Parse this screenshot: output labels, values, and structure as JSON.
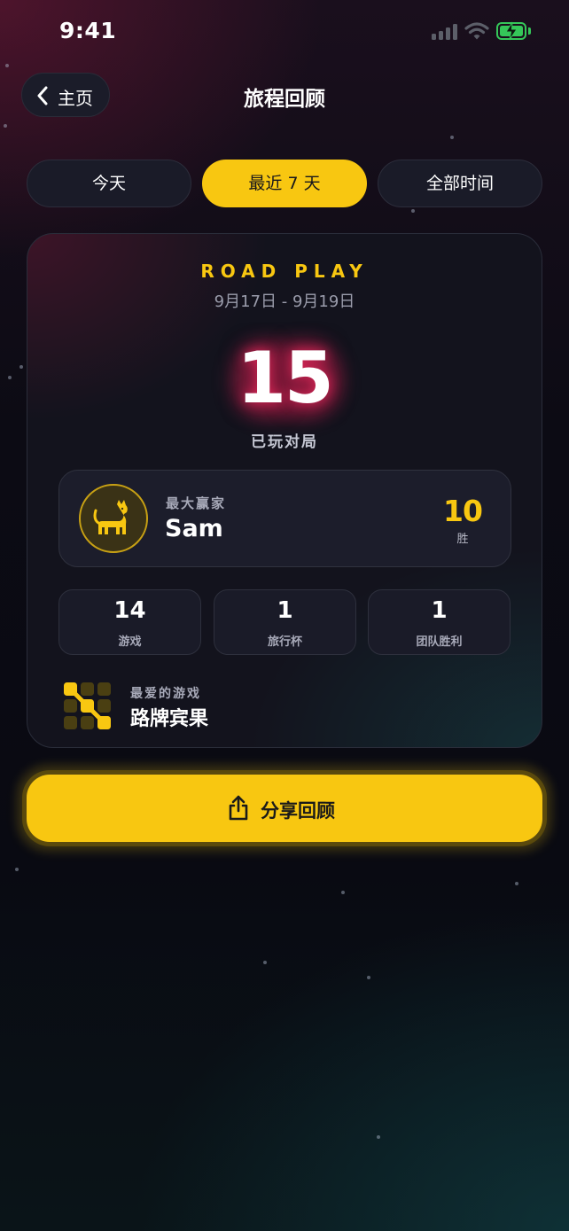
{
  "status_bar": {
    "time": "9:41"
  },
  "header": {
    "back_label": "主页",
    "title": "旅程回顾"
  },
  "tabs": [
    {
      "label": "今天",
      "active": false
    },
    {
      "label": "最近 7 天",
      "active": true
    },
    {
      "label": "全部时间",
      "active": false
    }
  ],
  "summary": {
    "brand": "ROAD PLAY",
    "date_range": "9月17日 - 9月19日",
    "games_played": "15",
    "games_played_label": "已玩对局"
  },
  "top_winner": {
    "label": "最大赢家",
    "name": "Sam",
    "avatar_icon": "cat-icon",
    "wins": "10",
    "wins_label": "胜"
  },
  "stats": [
    {
      "value": "14",
      "label": "游戏"
    },
    {
      "value": "1",
      "label": "旅行杯"
    },
    {
      "value": "1",
      "label": "团队胜利"
    }
  ],
  "favorite_game": {
    "label": "最爱的游戏",
    "name": "路牌宾果",
    "icon": "bingo-grid-icon"
  },
  "share_button": {
    "label": "分享回顾",
    "icon": "share-icon"
  },
  "colors": {
    "accent": "#f8c711",
    "battery": "#35c759",
    "glow": "#e0285a"
  }
}
